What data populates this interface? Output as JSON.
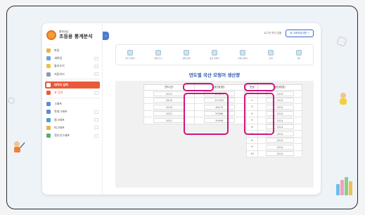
{
  "app": {
    "logo_sub": "통계교실",
    "logo_title": "초등용 통계분석"
  },
  "header": {
    "login_text": "로그인 하지 않음",
    "dashboard_button": "등 교화학습대원 →"
  },
  "sidebar": {
    "items": [
      {
        "label": "파일",
        "icon": "folder-icon",
        "color": "#f0b040"
      },
      {
        "label": "새파일",
        "icon": "new-file-icon",
        "color": "#6aa0e0"
      },
      {
        "label": "불러오기",
        "icon": "open-icon",
        "color": "#f0c040"
      },
      {
        "label": "저장하기",
        "icon": "save-icon",
        "color": "#8a9ab0"
      },
      {
        "label": "데이터 입력",
        "icon": "edit-icon",
        "color": "#ffffff"
      },
      {
        "label": "표 입력",
        "icon": "table-icon",
        "color": "#e85a3a"
      },
      {
        "label": "그래프",
        "icon": "graph-icon",
        "color": "#5a8ad0"
      },
      {
        "label": "막대그래프",
        "icon": "bar-chart-icon",
        "color": "#5a8ad0"
      },
      {
        "label": "원그래프",
        "icon": "pie-chart-icon",
        "color": "#4aa0d0"
      },
      {
        "label": "띠그래프",
        "icon": "band-chart-icon",
        "color": "#f0b040"
      },
      {
        "label": "꺾은선그래프",
        "icon": "line-chart-icon",
        "color": "#5aaa70"
      }
    ]
  },
  "toolbar": {
    "tools": [
      {
        "label": "열기 데이터"
      },
      {
        "label": "항목 추가"
      },
      {
        "label": "항목 정렬"
      },
      {
        "label": "표준 데이터"
      },
      {
        "label": "인쇄 데이터"
      },
      {
        "label": "합계"
      },
      {
        "label": "계산"
      }
    ]
  },
  "main": {
    "title": "연도별 국산 모링어 생산량",
    "table1": {
      "headers": [
        "연도(년)",
        "생산량(톤)"
      ],
      "rows": [
        [
          "2014",
          "103897"
        ],
        [
          "2016",
          "127491"
        ],
        [
          "2018",
          "48275"
        ],
        [
          "2020",
          "59586"
        ],
        [
          "2022",
          "39996"
        ]
      ]
    },
    "table2": {
      "headers": [
        "번호",
        "생산량(톤)"
      ],
      "rows": [
        [
          "1",
          "2014"
        ],
        [
          "2",
          "2014"
        ],
        [
          "3",
          "2014"
        ],
        [
          "4",
          "2014"
        ],
        [
          "5",
          "2014"
        ],
        [
          "6",
          "2014"
        ],
        [
          "7",
          "2014"
        ],
        [
          "8",
          "2014"
        ],
        [
          "9",
          "2014"
        ],
        [
          "10",
          "2014"
        ]
      ]
    }
  },
  "colors": {
    "accent": "#e85a3a",
    "highlight": "#d0157a",
    "title": "#2e57a8"
  }
}
